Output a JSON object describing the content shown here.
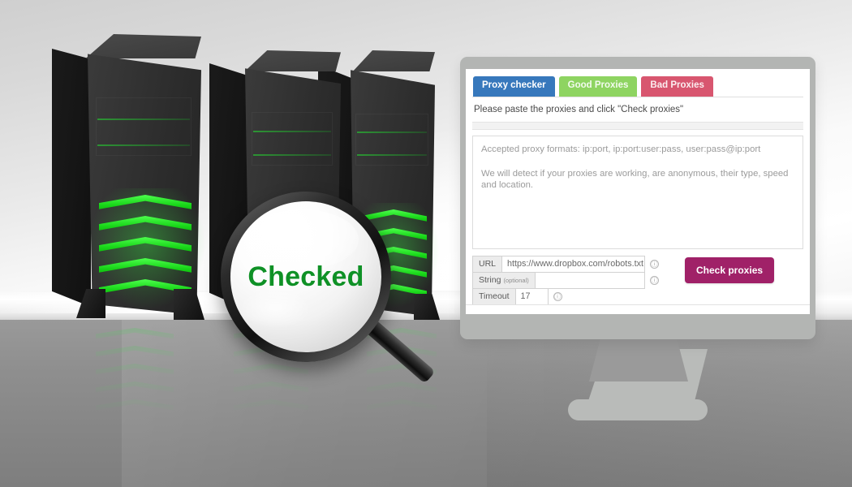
{
  "scene": {
    "magnifier_label": "Checked",
    "accent_green": "#0f9126",
    "tower_chevron_color": "#17d417"
  },
  "browser": {
    "tabs": [
      {
        "label": "Proxy checker",
        "color": "#3778bc",
        "active": true
      },
      {
        "label": "Good Proxies",
        "color": "#8ed461",
        "active": false
      },
      {
        "label": "Bad Proxies",
        "color": "#d8566f",
        "active": false
      }
    ],
    "instruction": "Please paste the proxies and click \"Check proxies\"",
    "textarea": {
      "line1": "Accepted proxy formats: ip:port, ip:port:user:pass, user:pass@ip:port",
      "line2": "We will detect if your proxies are working, are anonymous, their type, speed and location."
    },
    "form": {
      "url_label": "URL",
      "url_value": "https://www.dropbox.com/robots.txt",
      "string_label": "String",
      "string_optional": "(optional)",
      "string_value": "",
      "timeout_label": "Timeout",
      "timeout_value": "17",
      "help_icon": "ⓘ",
      "submit_label": "Check proxies",
      "submit_color": "#a02168"
    }
  }
}
